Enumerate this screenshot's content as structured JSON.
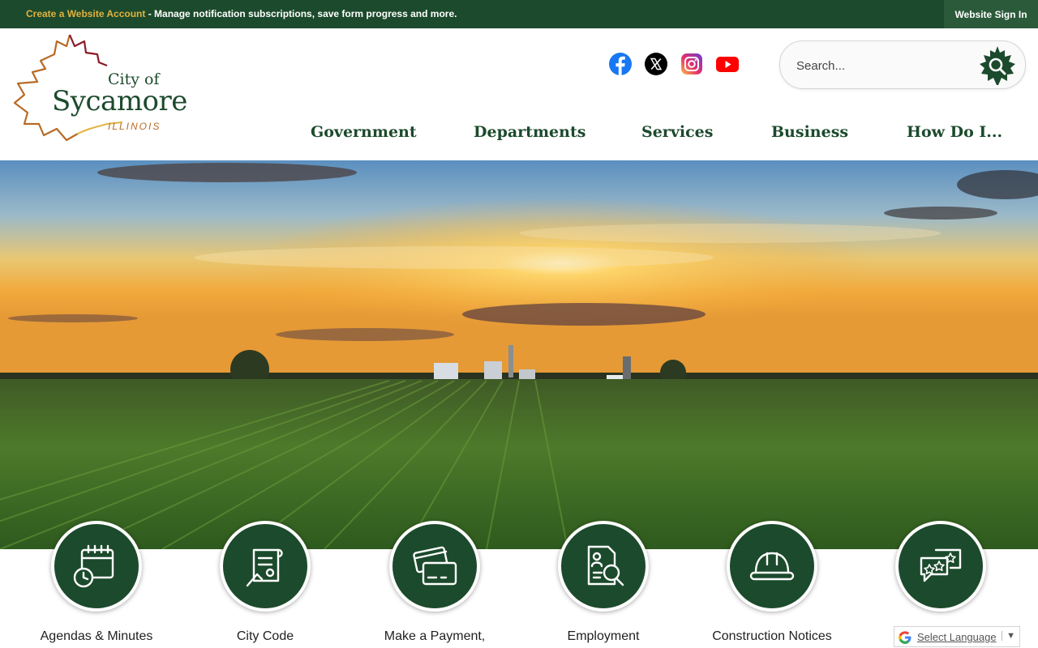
{
  "topbar": {
    "create_link": "Create a Website Account",
    "message": " - Manage notification subscriptions, save form progress and more.",
    "signin": "Website Sign In"
  },
  "logo": {
    "city_of": "City of",
    "name": "Sycamore",
    "state": "ILLINOIS"
  },
  "social": [
    "facebook-icon",
    "x-icon",
    "instagram-icon",
    "youtube-icon"
  ],
  "search": {
    "placeholder": "Search..."
  },
  "nav": [
    "Government",
    "Departments",
    "Services",
    "Business",
    "How Do I..."
  ],
  "quick_links": [
    "Agendas & Minutes",
    "City Code",
    "Make a Payment,",
    "Employment",
    "Construction Notices",
    ""
  ],
  "translate": {
    "label": "Select Language",
    "arrow": "▼"
  },
  "colors": {
    "brand_green": "#1c4a2c",
    "accent_gold": "#e2b23e",
    "leaf_orange": "#b86b26",
    "leaf_red": "#8b1a2a"
  }
}
